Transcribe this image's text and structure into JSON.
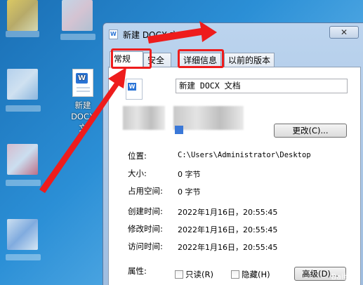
{
  "window": {
    "title": "新建 DOCX 文",
    "close_label": "✕"
  },
  "desktop": {
    "docx_label_line1": "新建 DOCX",
    "docx_label_line2": "文"
  },
  "tabs": [
    {
      "label": "常规",
      "active": true
    },
    {
      "label": "安全",
      "active": false
    },
    {
      "label": "详细信息",
      "active": false
    },
    {
      "label": "以前的版本",
      "active": false
    }
  ],
  "general": {
    "file_name": "新建 DOCX 文档",
    "change_button": "更改(C)...",
    "location_label": "位置:",
    "location_value": "C:\\Users\\Administrator\\Desktop",
    "size_label": "大小:",
    "size_value": "0 字节",
    "disk_label": "占用空间:",
    "disk_value": "0 字节",
    "created_label": "创建时间:",
    "created_value": "2022年1月16日，20:55:45",
    "modified_label": "修改时间:",
    "modified_value": "2022年1月16日，20:55:45",
    "accessed_label": "访问时间:",
    "accessed_value": "2022年1月16日，20:55:45",
    "attributes_label": "属性:",
    "readonly_label": "只读(R)",
    "hidden_label": "隐藏(H)",
    "advanced_button": "高级(D)..."
  },
  "watermark": "Bai经验",
  "colors": {
    "highlight": "#ee1c1c",
    "desktop": "#2b8fd6"
  }
}
